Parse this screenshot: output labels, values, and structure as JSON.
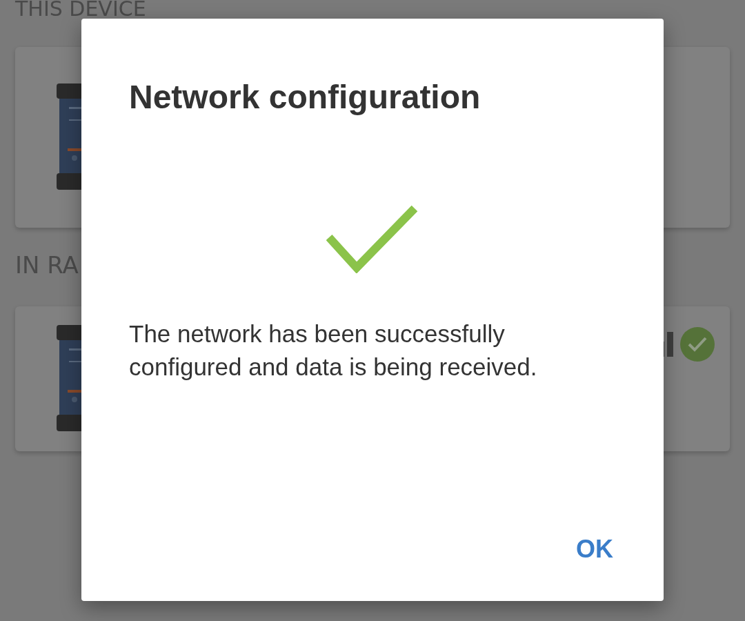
{
  "sections": [
    {
      "header": "THIS DEVICE"
    },
    {
      "header": "IN RA",
      "signal": true,
      "connected": true
    }
  ],
  "dialog": {
    "title": "Network configuration",
    "success": true,
    "message": "The network has been successfully configured and data is being received.",
    "buttons": [
      "OK"
    ]
  }
}
